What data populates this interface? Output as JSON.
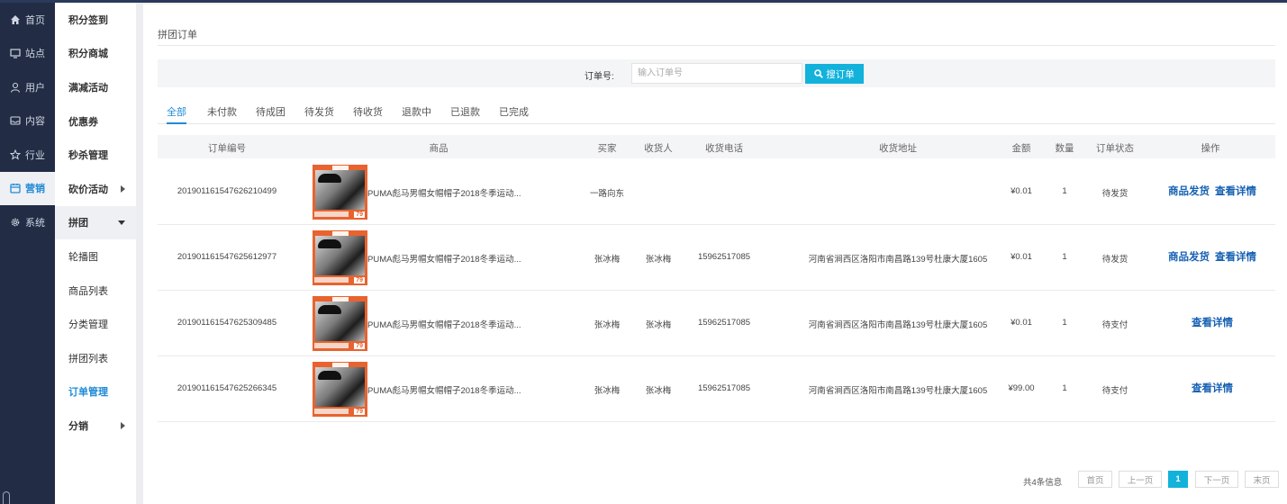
{
  "nav_primary": [
    {
      "label": "首页",
      "icon": "home-icon"
    },
    {
      "label": "站点",
      "icon": "monitor-icon"
    },
    {
      "label": "用户",
      "icon": "user-icon"
    },
    {
      "label": "内容",
      "icon": "inbox-icon"
    },
    {
      "label": "行业",
      "icon": "star-icon"
    },
    {
      "label": "营销",
      "icon": "calendar-icon",
      "active": true
    },
    {
      "label": "系统",
      "icon": "gear-icon"
    }
  ],
  "nav_secondary": [
    {
      "label": "积分签到",
      "type": "group"
    },
    {
      "label": "积分商城",
      "type": "group"
    },
    {
      "label": "满减活动",
      "type": "group"
    },
    {
      "label": "优惠券",
      "type": "group"
    },
    {
      "label": "秒杀管理",
      "type": "group"
    },
    {
      "label": "砍价活动",
      "type": "group",
      "arrow": "right"
    },
    {
      "label": "拼团",
      "type": "group",
      "arrow": "down",
      "open": true
    },
    {
      "label": "轮播图",
      "type": "sub"
    },
    {
      "label": "商品列表",
      "type": "sub"
    },
    {
      "label": "分类管理",
      "type": "sub"
    },
    {
      "label": "拼团列表",
      "type": "sub"
    },
    {
      "label": "订单管理",
      "type": "sub",
      "current": true
    },
    {
      "label": "分销",
      "type": "group",
      "arrow": "right"
    }
  ],
  "page": {
    "title": "拼团订单"
  },
  "search": {
    "label": "订单号:",
    "placeholder": "输入订单号",
    "button_label": "搜订单"
  },
  "tabs": [
    "全部",
    "未付款",
    "待成团",
    "待发货",
    "待收货",
    "退款中",
    "已退款",
    "已完成"
  ],
  "table": {
    "headers": [
      "订单编号",
      "商品",
      "买家",
      "收货人",
      "收货电话",
      "收货地址",
      "金额",
      "数量",
      "订单状态",
      "操作"
    ],
    "rows": [
      {
        "order_no": "201901161547626210499",
        "goods": "PUMA彪马男帽女帽帽子2018冬季运动...",
        "buyer": "一路向东",
        "receiver": "",
        "phone": "",
        "address": "",
        "amount": "¥0.01",
        "qty": "1",
        "status": "待发货",
        "actions": [
          "商品发货",
          "查看详情"
        ]
      },
      {
        "order_no": "201901161547625612977",
        "goods": "PUMA彪马男帽女帽帽子2018冬季运动...",
        "buyer": "张冰梅",
        "receiver": "张冰梅",
        "phone": "15962517085",
        "address": "河南省涧西区洛阳市南昌路139号杜康大厦1605",
        "amount": "¥0.01",
        "qty": "1",
        "status": "待发货",
        "actions": [
          "商品发货",
          "查看详情"
        ]
      },
      {
        "order_no": "201901161547625309485",
        "goods": "PUMA彪马男帽女帽帽子2018冬季运动...",
        "buyer": "张冰梅",
        "receiver": "张冰梅",
        "phone": "15962517085",
        "address": "河南省涧西区洛阳市南昌路139号杜康大厦1605",
        "amount": "¥0.01",
        "qty": "1",
        "status": "待支付",
        "actions": [
          "查看详情"
        ]
      },
      {
        "order_no": "201901161547625266345",
        "goods": "PUMA彪马男帽女帽帽子2018冬季运动...",
        "buyer": "张冰梅",
        "receiver": "张冰梅",
        "phone": "15962517085",
        "address": "河南省涧西区洛阳市南昌路139号杜康大厦1605",
        "amount": "¥99.00",
        "qty": "1",
        "status": "待支付",
        "actions": [
          "查看详情"
        ]
      }
    ]
  },
  "thumb": {
    "price": "79"
  },
  "pagination": {
    "info": "共4条信息",
    "first": "首页",
    "prev": "上一页",
    "current": "1",
    "next": "下一页",
    "last": "末页"
  },
  "colors": {
    "sidebar": "#222d45",
    "accent": "#1f8ad6",
    "button": "#12b2db",
    "action_link": "#1761b3",
    "thumb": "#e8632f"
  }
}
